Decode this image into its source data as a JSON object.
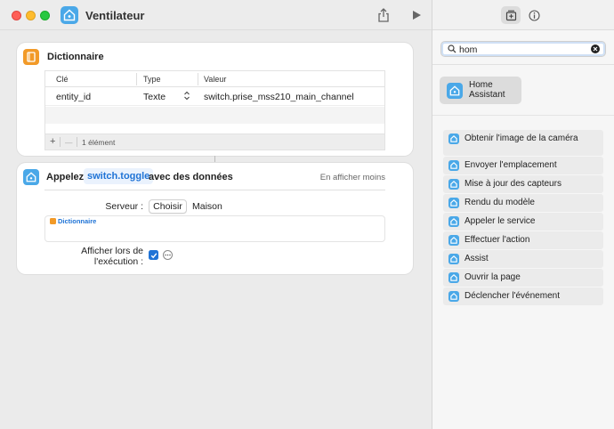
{
  "window": {
    "title": "Ventilateur"
  },
  "dictionary_card": {
    "title": "Dictionnaire",
    "columns": [
      "Clé",
      "Type",
      "Valeur"
    ],
    "rows": [
      {
        "key": "entity_id",
        "type": "Texte",
        "value": "switch.prise_mss210_main_channel"
      }
    ],
    "footer": {
      "add": "+",
      "remove": "—",
      "count": "1 élément"
    }
  },
  "action_card": {
    "prefix": "Appelez",
    "service": "switch.toggle",
    "suffix": "avec des données",
    "show_less": "En afficher moins",
    "server_label": "Serveur :",
    "choose_label": "Choisir",
    "server_value": "Maison",
    "data_token": "Dictionnaire",
    "show_when_run_label_1": "Afficher lors de",
    "show_when_run_label_2": "l'exécution :",
    "show_when_run_checked": true
  },
  "sidebar": {
    "search": {
      "value": "hom"
    },
    "app": {
      "label": "Home Assistant"
    },
    "actions": [
      {
        "label": "Obtenir l'image de la caméra"
      },
      {
        "label": "Envoyer l'emplacement"
      },
      {
        "label": "Mise à jour des capteurs"
      },
      {
        "label": "Rendu du modèle"
      },
      {
        "label": "Appeler le service"
      },
      {
        "label": "Effectuer l'action"
      },
      {
        "label": "Assist"
      },
      {
        "label": "Ouvrir la page"
      },
      {
        "label": "Déclencher l'événement"
      }
    ]
  },
  "colors": {
    "accent": "#1f73d6",
    "ha_blue": "#4aa8e8",
    "dict_orange": "#f29a28"
  }
}
